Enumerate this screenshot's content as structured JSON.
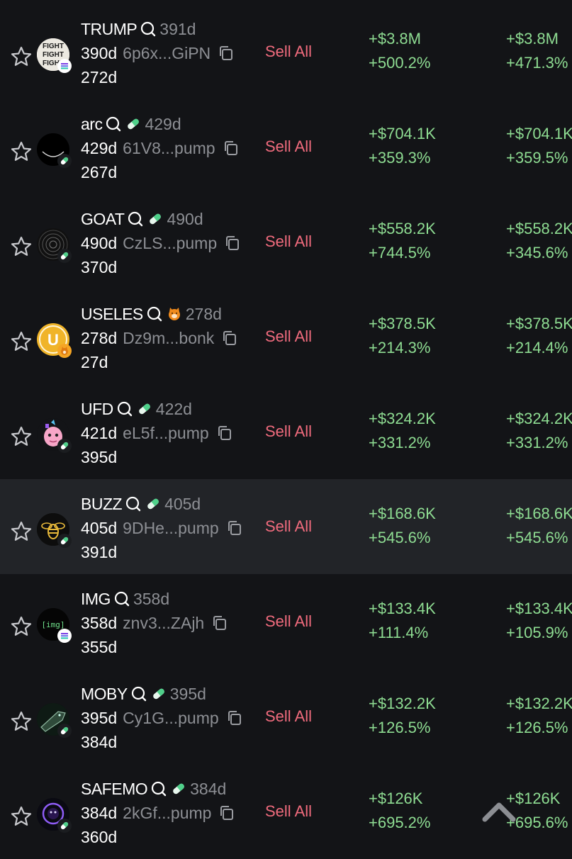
{
  "actions": {
    "sell_all_label": "Sell All"
  },
  "colors": {
    "background": "#131417",
    "highlight_row": "#222428",
    "profit": "#8edc92",
    "sell": "#f06b7d",
    "muted": "#8d8f94"
  },
  "rows": [
    {
      "symbol": "TRUMP",
      "platform_icon": "none",
      "age_top": "391d",
      "age_main": "390d",
      "address": "6p6x...GiPN",
      "age_bottom": "272d",
      "value_1": "+$3.8M",
      "pct_1": "+500.2%",
      "value_2": "+$3.8M",
      "pct_2": "+471.3%",
      "avatar": "trump-fight-avatar",
      "badge": "solana-icon",
      "highlighted": false
    },
    {
      "symbol": "arc",
      "platform_icon": "pill-icon",
      "age_top": "429d",
      "age_main": "429d",
      "address": "61V8...pump",
      "age_bottom": "267d",
      "value_1": "+$704.1K",
      "pct_1": "+359.3%",
      "value_2": "+$704.1K",
      "pct_2": "+359.5%",
      "avatar": "arc-avatar",
      "badge": "pill-icon",
      "highlighted": false
    },
    {
      "symbol": "GOAT",
      "platform_icon": "pill-icon",
      "age_top": "490d",
      "age_main": "490d",
      "address": "CzLS...pump",
      "age_bottom": "370d",
      "value_1": "+$558.2K",
      "pct_1": "+744.5%",
      "value_2": "+$558.2K",
      "pct_2": "+345.6%",
      "avatar": "goat-avatar",
      "badge": "pill-icon",
      "highlighted": false
    },
    {
      "symbol": "USELES",
      "platform_icon": "bonk-icon",
      "age_top": "278d",
      "age_main": "278d",
      "address": "Dz9m...bonk",
      "age_bottom": "27d",
      "value_1": "+$378.5K",
      "pct_1": "+214.3%",
      "value_2": "+$378.5K",
      "pct_2": "+214.4%",
      "avatar": "useles-coin-avatar",
      "badge": "bonk-icon",
      "highlighted": false
    },
    {
      "symbol": "UFD",
      "platform_icon": "pill-icon",
      "age_top": "422d",
      "age_main": "421d",
      "address": "eL5f...pump",
      "age_bottom": "395d",
      "value_1": "+$324.2K",
      "pct_1": "+331.2%",
      "value_2": "+$324.2K",
      "pct_2": "+331.2%",
      "avatar": "ufd-unicorn-avatar",
      "badge": "pill-icon",
      "highlighted": false
    },
    {
      "symbol": "BUZZ",
      "platform_icon": "pill-icon",
      "age_top": "405d",
      "age_main": "405d",
      "address": "9DHe...pump",
      "age_bottom": "391d",
      "value_1": "+$168.6K",
      "pct_1": "+545.6%",
      "value_2": "+$168.6K",
      "pct_2": "+545.6%",
      "avatar": "buzz-bee-avatar",
      "badge": "pill-icon",
      "highlighted": true
    },
    {
      "symbol": "IMG",
      "platform_icon": "none",
      "age_top": "358d",
      "age_main": "358d",
      "address": "znv3...ZAjh",
      "age_bottom": "355d",
      "value_1": "+$133.4K",
      "pct_1": "+111.4%",
      "value_2": "+$133.4K",
      "pct_2": "+105.9%",
      "avatar": "img-avatar",
      "avatar_text": "[img]",
      "badge": "solana-icon",
      "highlighted": false
    },
    {
      "symbol": "MOBY",
      "platform_icon": "pill-icon",
      "age_top": "395d",
      "age_main": "395d",
      "address": "Cy1G...pump",
      "age_bottom": "384d",
      "value_1": "+$132.2K",
      "pct_1": "+126.5%",
      "value_2": "+$132.2K",
      "pct_2": "+126.5%",
      "avatar": "moby-whale-avatar",
      "badge": "pill-icon",
      "highlighted": false
    },
    {
      "symbol": "SAFEMO",
      "platform_icon": "pill-icon",
      "age_top": "384d",
      "age_main": "384d",
      "address": "2kGf...pump",
      "age_bottom": "360d",
      "value_1": "+$126K",
      "pct_1": "+695.2%",
      "value_2": "+$126K",
      "pct_2": "+695.6%",
      "avatar": "safemo-avatar",
      "badge": "pill-icon",
      "highlighted": false
    }
  ]
}
